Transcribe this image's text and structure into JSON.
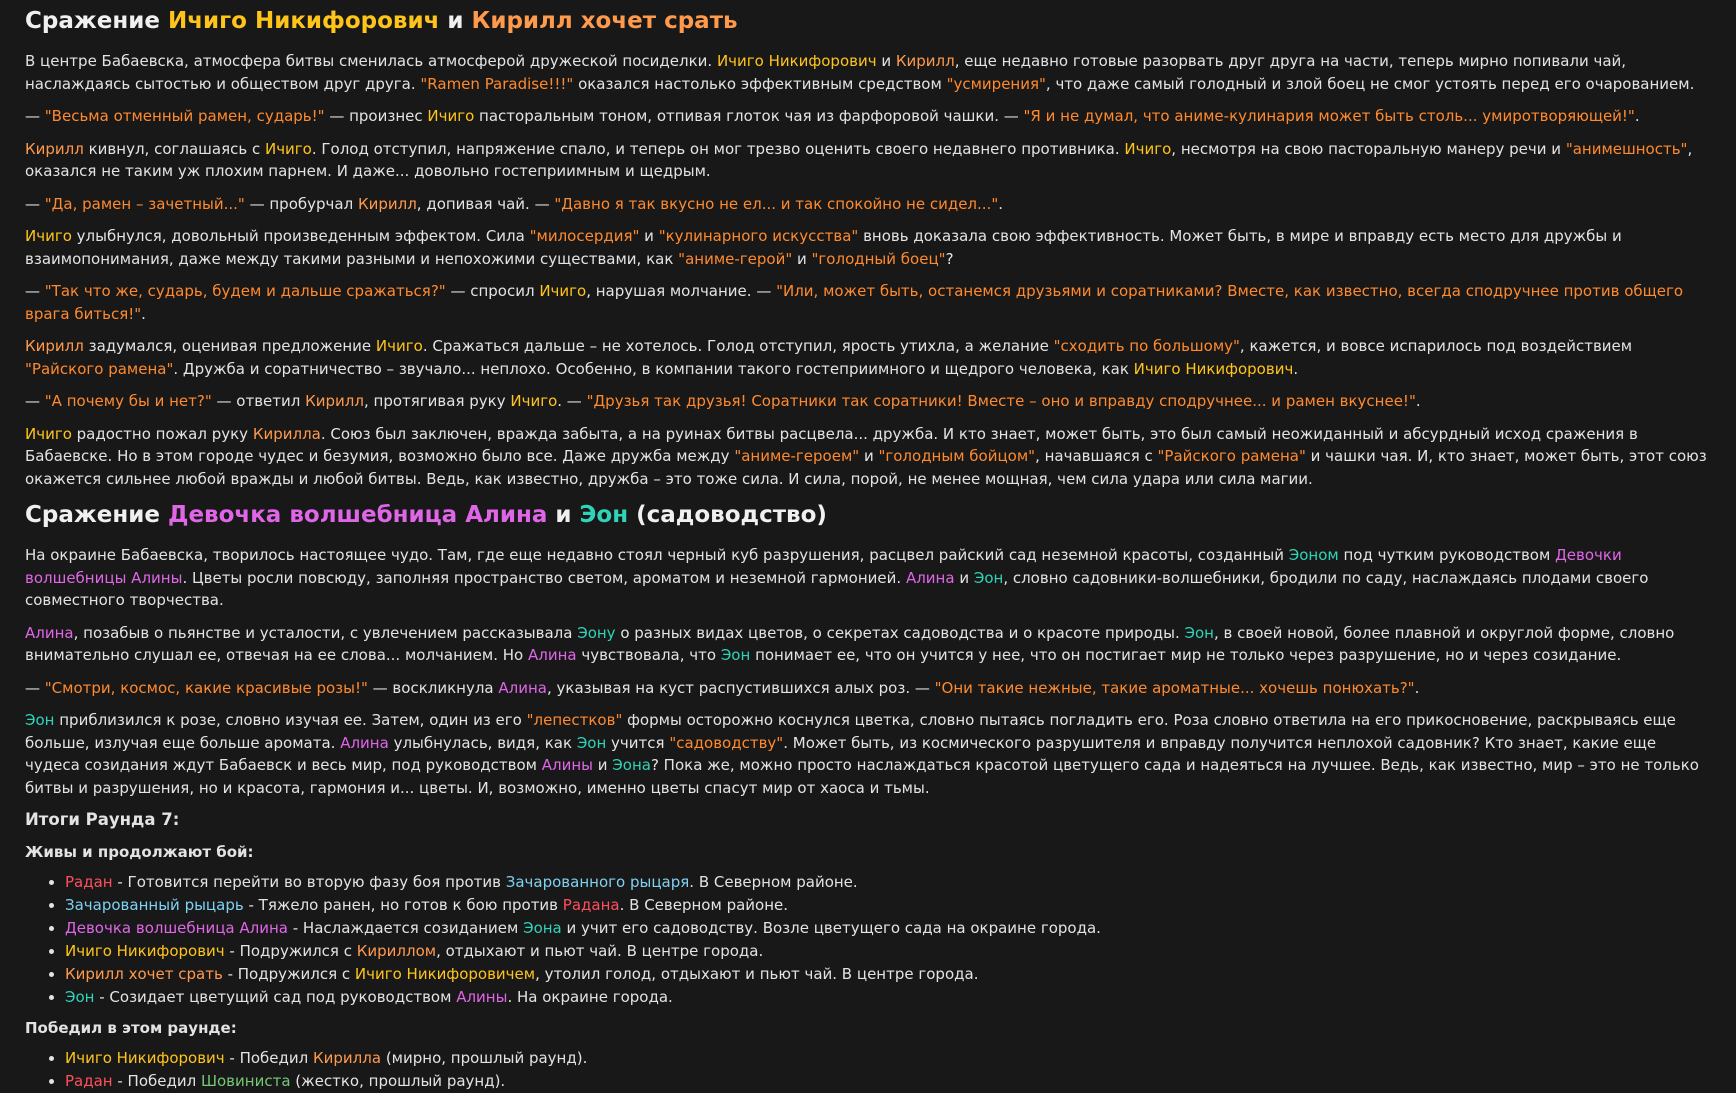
{
  "section1": {
    "title_parts": [
      {
        "t": "Сражение ",
        "c": ""
      },
      {
        "t": "Ичиго Никифорович",
        "c": "y"
      },
      {
        "t": " и ",
        "c": ""
      },
      {
        "t": "Кирилл хочет срать",
        "c": "o"
      }
    ],
    "paragraphs": [
      [
        {
          "t": "В центре Бабаевска, атмосфера битвы сменилась атмосферой дружеской посиделки. ",
          "c": ""
        },
        {
          "t": "Ичиго Никифорович",
          "c": "y"
        },
        {
          "t": " и ",
          "c": ""
        },
        {
          "t": "Кирилл",
          "c": "o"
        },
        {
          "t": ", еще недавно готовые разорвать друг друга на части, теперь мирно попивали чай, наслаждаясь сытостью и обществом друг друга. ",
          "c": ""
        },
        {
          "t": "\"Ramen Paradise!!!\"",
          "c": "q"
        },
        {
          "t": " оказался настолько эффективным средством ",
          "c": ""
        },
        {
          "t": "\"усмирения\"",
          "c": "q"
        },
        {
          "t": ", что даже самый голодный и злой боец не смог устоять перед его очарованием.",
          "c": ""
        }
      ],
      [
        {
          "t": "— ",
          "c": ""
        },
        {
          "t": "\"Весьма отменный рамен, сударь!\"",
          "c": "q"
        },
        {
          "t": " — произнес ",
          "c": ""
        },
        {
          "t": "Ичиго",
          "c": "y"
        },
        {
          "t": " пасторальным тоном, отпивая глоток чая из фарфоровой чашки. — ",
          "c": ""
        },
        {
          "t": "\"Я и не думал, что аниме-кулинария может быть столь... умиротворяющей!\"",
          "c": "q"
        },
        {
          "t": ".",
          "c": ""
        }
      ],
      [
        {
          "t": "Кирилл",
          "c": "o"
        },
        {
          "t": " кивнул, соглашаясь с ",
          "c": ""
        },
        {
          "t": "Ичиго",
          "c": "y"
        },
        {
          "t": ". Голод отступил, напряжение спало, и теперь он мог трезво оценить своего недавнего противника. ",
          "c": ""
        },
        {
          "t": "Ичиго",
          "c": "y"
        },
        {
          "t": ", несмотря на свою пасторальную манеру речи и ",
          "c": ""
        },
        {
          "t": "\"анимешность\"",
          "c": "q"
        },
        {
          "t": ", оказался не таким уж плохим парнем. И даже... довольно гостеприимным и щедрым.",
          "c": ""
        }
      ],
      [
        {
          "t": "— ",
          "c": ""
        },
        {
          "t": "\"Да, рамен – зачетный...\"",
          "c": "q"
        },
        {
          "t": " — пробурчал ",
          "c": ""
        },
        {
          "t": "Кирилл",
          "c": "o"
        },
        {
          "t": ", допивая чай. — ",
          "c": ""
        },
        {
          "t": "\"Давно я так вкусно не ел... и так спокойно не сидел...\"",
          "c": "q"
        },
        {
          "t": ".",
          "c": ""
        }
      ],
      [
        {
          "t": "Ичиго",
          "c": "y"
        },
        {
          "t": " улыбнулся, довольный произведенным эффектом. Сила ",
          "c": ""
        },
        {
          "t": "\"милосердия\"",
          "c": "q"
        },
        {
          "t": " и ",
          "c": ""
        },
        {
          "t": "\"кулинарного искусства\"",
          "c": "q"
        },
        {
          "t": " вновь доказала свою эффективность. Может быть, в мире и вправду есть место для дружбы и взаимопонимания, даже между такими разными и непохожими существами, как ",
          "c": ""
        },
        {
          "t": "\"аниме-герой\"",
          "c": "q"
        },
        {
          "t": " и ",
          "c": ""
        },
        {
          "t": "\"голодный боец\"",
          "c": "q"
        },
        {
          "t": "?",
          "c": ""
        }
      ],
      [
        {
          "t": "— ",
          "c": ""
        },
        {
          "t": "\"Так что же, сударь, будем и дальше сражаться?\"",
          "c": "q"
        },
        {
          "t": " — спросил ",
          "c": ""
        },
        {
          "t": "Ичиго",
          "c": "y"
        },
        {
          "t": ", нарушая молчание. — ",
          "c": ""
        },
        {
          "t": "\"Или, может быть, останемся друзьями и соратниками? Вместе, как известно, всегда сподручнее против общего врага биться!\"",
          "c": "q"
        },
        {
          "t": ".",
          "c": ""
        }
      ],
      [
        {
          "t": "Кирилл",
          "c": "o"
        },
        {
          "t": " задумался, оценивая предложение ",
          "c": ""
        },
        {
          "t": "Ичиго",
          "c": "y"
        },
        {
          "t": ". Сражаться дальше – не хотелось. Голод отступил, ярость утихла, а желание ",
          "c": ""
        },
        {
          "t": "\"сходить по большому\"",
          "c": "q"
        },
        {
          "t": ", кажется, и вовсе испарилось под воздействием ",
          "c": ""
        },
        {
          "t": "\"Райского рамена\"",
          "c": "q"
        },
        {
          "t": ". Дружба и соратничество – звучало... неплохо. Особенно, в компании такого гостеприимного и щедрого человека, как ",
          "c": ""
        },
        {
          "t": "Ичиго Никифорович",
          "c": "y"
        },
        {
          "t": ".",
          "c": ""
        }
      ],
      [
        {
          "t": "— ",
          "c": ""
        },
        {
          "t": "\"А почему бы и нет?\"",
          "c": "q"
        },
        {
          "t": " — ответил ",
          "c": ""
        },
        {
          "t": "Кирилл",
          "c": "o"
        },
        {
          "t": ", протягивая руку ",
          "c": ""
        },
        {
          "t": "Ичиго",
          "c": "y"
        },
        {
          "t": ". — ",
          "c": ""
        },
        {
          "t": "\"Друзья так друзья! Соратники так соратники! Вместе – оно и вправду сподручнее... и рамен вкуснее!\"",
          "c": "q"
        },
        {
          "t": ".",
          "c": ""
        }
      ],
      [
        {
          "t": "Ичиго",
          "c": "y"
        },
        {
          "t": " радостно пожал руку ",
          "c": ""
        },
        {
          "t": "Кирилла",
          "c": "o"
        },
        {
          "t": ". Союз был заключен, вражда забыта, а на руинах битвы расцвела... дружба. И кто знает, может быть, это был самый неожиданный и абсурдный исход сражения в Бабаевске. Но в этом городе чудес и безумия, возможно было все. Даже дружба между ",
          "c": ""
        },
        {
          "t": "\"аниме-героем\"",
          "c": "q"
        },
        {
          "t": " и ",
          "c": ""
        },
        {
          "t": "\"голодным бойцом\"",
          "c": "q"
        },
        {
          "t": ", начавшаяся с ",
          "c": ""
        },
        {
          "t": "\"Райского рамена\"",
          "c": "q"
        },
        {
          "t": " и чашки чая. И, кто знает, может быть, этот союз окажется сильнее любой вражды и любой битвы. Ведь, как известно, дружба – это тоже сила. И сила, порой, не менее мощная, чем сила удара или сила магии.",
          "c": ""
        }
      ]
    ]
  },
  "section2": {
    "title_parts": [
      {
        "t": "Сражение ",
        "c": ""
      },
      {
        "t": "Девочка волшебница Алина",
        "c": "m"
      },
      {
        "t": " и ",
        "c": ""
      },
      {
        "t": "Эон",
        "c": "t"
      },
      {
        "t": " (садоводство)",
        "c": ""
      }
    ],
    "paragraphs": [
      [
        {
          "t": "На окраине Бабаевска, творилось настоящее чудо. Там, где еще недавно стоял черный куб разрушения, расцвел райский сад неземной красоты, созданный ",
          "c": ""
        },
        {
          "t": "Эоном",
          "c": "t"
        },
        {
          "t": " под чутким руководством ",
          "c": ""
        },
        {
          "t": "Девочки волшебницы Алины",
          "c": "m"
        },
        {
          "t": ". Цветы росли повсюду, заполняя пространство светом, ароматом и неземной гармонией. ",
          "c": ""
        },
        {
          "t": "Алина",
          "c": "m"
        },
        {
          "t": " и ",
          "c": ""
        },
        {
          "t": "Эон",
          "c": "t"
        },
        {
          "t": ", словно садовники-волшебники, бродили по саду, наслаждаясь плодами своего совместного творчества.",
          "c": ""
        }
      ],
      [
        {
          "t": "Алина",
          "c": "m"
        },
        {
          "t": ", позабыв о пьянстве и усталости, с увлечением рассказывала ",
          "c": ""
        },
        {
          "t": "Эону",
          "c": "t"
        },
        {
          "t": " о разных видах цветов, о секретах садоводства и о красоте природы. ",
          "c": ""
        },
        {
          "t": "Эон",
          "c": "t"
        },
        {
          "t": ", в своей новой, более плавной и округлой форме, словно внимательно слушал ее, отвечая на ее слова... молчанием. Но ",
          "c": ""
        },
        {
          "t": "Алина",
          "c": "m"
        },
        {
          "t": " чувствовала, что ",
          "c": ""
        },
        {
          "t": "Эон",
          "c": "t"
        },
        {
          "t": " понимает ее, что он учится у нее, что он постигает мир не только через разрушение, но и через созидание.",
          "c": ""
        }
      ],
      [
        {
          "t": "— ",
          "c": ""
        },
        {
          "t": "\"Смотри, космос, какие красивые розы!\"",
          "c": "q"
        },
        {
          "t": " — воскликнула ",
          "c": ""
        },
        {
          "t": "Алина",
          "c": "m"
        },
        {
          "t": ", указывая на куст распустившихся алых роз. — ",
          "c": ""
        },
        {
          "t": "\"Они такие нежные, такие ароматные... хочешь понюхать?\"",
          "c": "q"
        },
        {
          "t": ".",
          "c": ""
        }
      ],
      [
        {
          "t": "Эон",
          "c": "t"
        },
        {
          "t": " приблизился к розе, словно изучая ее. Затем, один из его ",
          "c": ""
        },
        {
          "t": "\"лепестков\"",
          "c": "q"
        },
        {
          "t": " формы осторожно коснулся цветка, словно пытаясь погладить его. Роза словно ответила на его прикосновение, раскрываясь еще больше, излучая еще больше аромата. ",
          "c": ""
        },
        {
          "t": "Алина",
          "c": "m"
        },
        {
          "t": " улыбнулась, видя, как ",
          "c": ""
        },
        {
          "t": "Эон",
          "c": "t"
        },
        {
          "t": " учится ",
          "c": ""
        },
        {
          "t": "\"садоводству\"",
          "c": "q"
        },
        {
          "t": ". Может быть, из космического разрушителя и вправду получится неплохой садовник? Кто знает, какие еще чудеса созидания ждут Бабаевск и весь мир, под руководством ",
          "c": ""
        },
        {
          "t": "Алины",
          "c": "m"
        },
        {
          "t": " и ",
          "c": ""
        },
        {
          "t": "Эона",
          "c": "t"
        },
        {
          "t": "? Пока же, можно просто наслаждаться красотой цветущего сада и надеяться на лучшее. Ведь, как известно, мир – это не только битвы и разрушения, но и красота, гармония и... цветы. И, возможно, именно цветы спасут мир от хаоса и тьмы.",
          "c": ""
        }
      ]
    ]
  },
  "summary": {
    "title": "Итоги Раунда 7:",
    "alive_heading": "Живы и продолжают бой:",
    "alive": [
      [
        {
          "t": "Радан",
          "c": "r"
        },
        {
          "t": " - Готовится перейти во вторую фазу боя против ",
          "c": ""
        },
        {
          "t": "Зачарованного рыцаря",
          "c": "b"
        },
        {
          "t": ". В Северном районе.",
          "c": ""
        }
      ],
      [
        {
          "t": "Зачарованный рыцарь",
          "c": "b"
        },
        {
          "t": " - Тяжело ранен, но готов к бою против ",
          "c": ""
        },
        {
          "t": "Радана",
          "c": "r"
        },
        {
          "t": ". В Северном районе.",
          "c": ""
        }
      ],
      [
        {
          "t": "Девочка волшебница Алина",
          "c": "m"
        },
        {
          "t": " - Наслаждается созиданием ",
          "c": ""
        },
        {
          "t": "Эона",
          "c": "t"
        },
        {
          "t": " и учит его садоводству. Возле цветущего сада на окраине города.",
          "c": ""
        }
      ],
      [
        {
          "t": "Ичиго Никифорович",
          "c": "y"
        },
        {
          "t": " - Подружился с ",
          "c": ""
        },
        {
          "t": "Кириллом",
          "c": "o"
        },
        {
          "t": ", отдыхают и пьют чай. В центре города.",
          "c": ""
        }
      ],
      [
        {
          "t": "Кирилл хочет срать",
          "c": "o"
        },
        {
          "t": " - Подружился с ",
          "c": ""
        },
        {
          "t": "Ичиго Никифоровичем",
          "c": "y"
        },
        {
          "t": ", утолил голод, отдыхают и пьют чай. В центре города.",
          "c": ""
        }
      ],
      [
        {
          "t": "Эон",
          "c": "t"
        },
        {
          "t": " - Созидает цветущий сад под руководством ",
          "c": ""
        },
        {
          "t": "Алины",
          "c": "m"
        },
        {
          "t": ". На окраине города.",
          "c": ""
        }
      ]
    ],
    "winners_heading": "Победил в этом раунде:",
    "winners": [
      [
        {
          "t": "Ичиго Никифорович",
          "c": "y"
        },
        {
          "t": " - Победил ",
          "c": ""
        },
        {
          "t": "Кирилла",
          "c": "o"
        },
        {
          "t": " (мирно, прошлый раунд).",
          "c": ""
        }
      ],
      [
        {
          "t": "Радан",
          "c": "r"
        },
        {
          "t": " - Победил ",
          "c": ""
        },
        {
          "t": "Шовиниста",
          "c": "g"
        },
        {
          "t": " (жестко, прошлый раунд).",
          "c": ""
        }
      ]
    ]
  },
  "colors": {
    "background": "#181818",
    "text": "#e3e3e3",
    "ichigo": "#ffc41a",
    "kirill": "#ff9a4d",
    "quote": "#ff8a2e",
    "alina": "#e066e8",
    "eon": "#2fd4b8",
    "radan": "#ff4f5e",
    "knight": "#7fd1f2",
    "chauvinist": "#76c776"
  }
}
